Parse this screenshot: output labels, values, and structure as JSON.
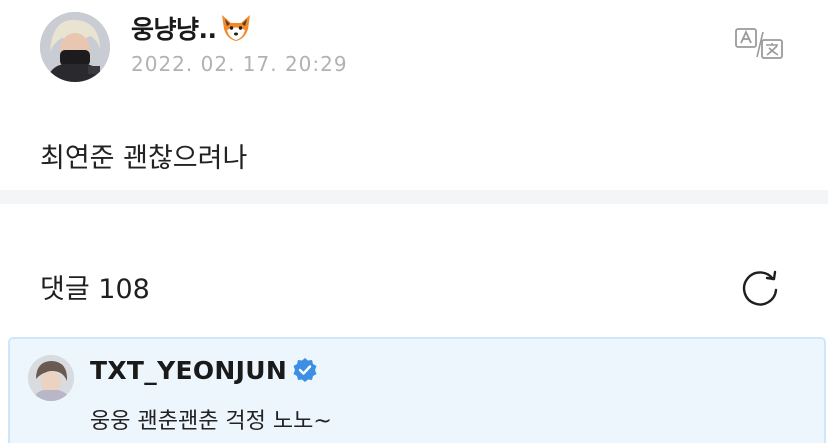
{
  "post": {
    "author_name": "웅냥냥..",
    "author_emoji_icon": "fox-face-icon",
    "date": "2022. 02. 17. 20:29",
    "body": "최연준 괜찮으려나",
    "translate_icon": "translate-icon"
  },
  "comments": {
    "count_label": "댓글 108",
    "refresh_icon": "refresh-icon"
  },
  "highlight_comment": {
    "author": "TXT_YEONJUN",
    "verified_icon": "verified-badge-icon",
    "text": "웅웅 괜춘괜춘 걱정 노노~"
  },
  "colors": {
    "date_gray": "#b2b2b2",
    "divider": "#f4f5f7",
    "highlight_bg": "#eef6fd",
    "highlight_border": "#cfe6f9",
    "verified_blue": "#3d8fe6"
  }
}
